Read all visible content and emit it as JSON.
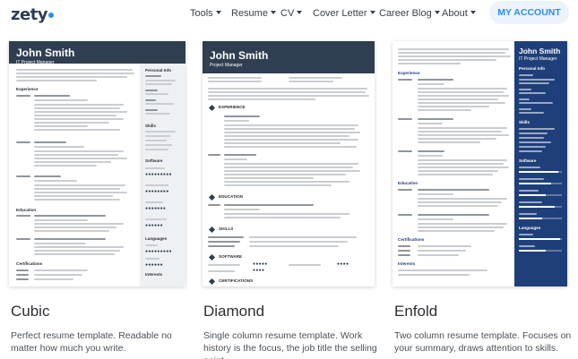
{
  "nav": {
    "logo": "zety",
    "items": [
      {
        "label": "Tools",
        "name": "nav-tools"
      },
      {
        "label": "Resume",
        "name": "nav-resume"
      },
      {
        "label": "CV",
        "name": "nav-cv"
      },
      {
        "label": "Cover Letter",
        "name": "nav-cover-letter"
      },
      {
        "label": "Career Blog",
        "name": "nav-career-blog"
      },
      {
        "label": "About",
        "name": "nav-about"
      }
    ],
    "account_button": "MY ACCOUNT"
  },
  "templates": [
    {
      "name": "Cubic",
      "description": "Perfect resume template. Readable no matter how much you write.",
      "preview": {
        "person": "John Smith",
        "job": "IT Project Manager",
        "sidebar_sections": [
          "Personal Info",
          "Skills",
          "Software",
          "Languages",
          "Interests"
        ],
        "main_sections": [
          "Experience",
          "Education",
          "Certifications"
        ]
      }
    },
    {
      "name": "Diamond",
      "description": "Single column resume template. Work history is the focus, the job title the selling point.",
      "preview": {
        "person": "John Smith",
        "job": "Project Manager",
        "main_sections": [
          "EXPERIENCE",
          "EDUCATION",
          "SKILLS",
          "SOFTWARE",
          "CERTIFICATIONS"
        ]
      }
    },
    {
      "name": "Enfold",
      "description": "Two column resume template. Focuses on your summary, draws attention to skills.",
      "preview": {
        "person": "John Smith",
        "job": "IT Project Manager",
        "sidebar_sections": [
          "Personal Info",
          "Skills",
          "Software",
          "Languages"
        ],
        "main_sections": [
          "Experience",
          "Education",
          "Certifications",
          "Interests"
        ]
      }
    }
  ],
  "colors": {
    "brand_blue": "#2b8ef0",
    "header_dark": "#2f3e50",
    "enfold_blue": "#1f3f7a",
    "account_bg": "#edf3fb"
  }
}
